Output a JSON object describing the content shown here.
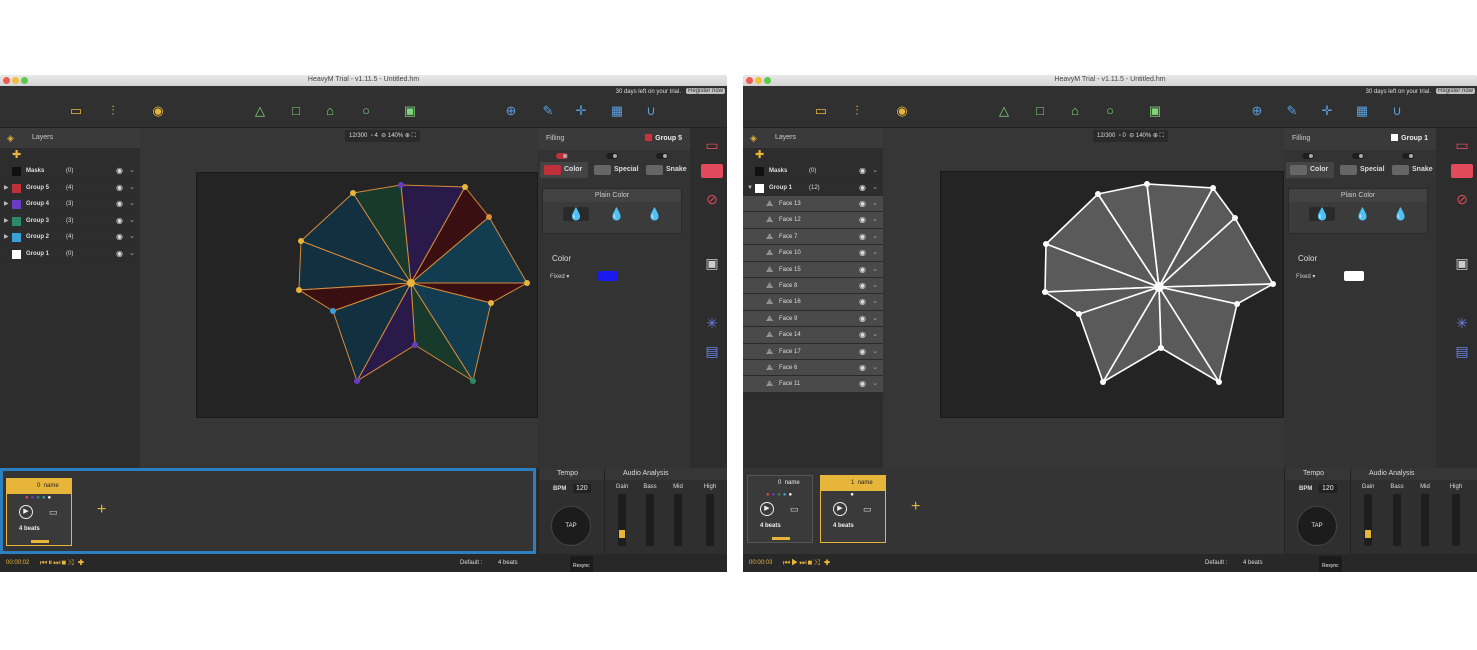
{
  "windows": [
    {
      "title": "HeavyM Trial - v1.11.5 - Untitled.hm",
      "trial_text": "30 days left on your trial.",
      "register_label": "Register now",
      "layers_label": "Layers",
      "canvas_faces": "12/300",
      "canvas_count": "4",
      "zoom": "140%",
      "layers": [
        {
          "name": "Masks",
          "count": "(0)",
          "color": "#111111"
        },
        {
          "name": "Group 5",
          "count": "(4)",
          "color": "#c0303a"
        },
        {
          "name": "Group 4",
          "count": "(3)",
          "color": "#6a3cc4"
        },
        {
          "name": "Group 3",
          "count": "(3)",
          "color": "#2a8a6a"
        },
        {
          "name": "Group 2",
          "count": "(4)",
          "color": "#3aa0d8"
        },
        {
          "name": "Group 1",
          "count": "(0)",
          "color": "#ffffff"
        }
      ],
      "props": {
        "filling": "Filling",
        "group": "Group 5",
        "group_color": "#d0303a",
        "tabs": [
          "Color",
          "Special",
          "Snake"
        ],
        "plain_color": "Plain Color",
        "color_label": "Color",
        "fixed": "Fixed",
        "swatch": "#1a1aee"
      },
      "clips": [
        {
          "index": "0",
          "name": "name",
          "beats": "4 beats"
        }
      ],
      "time": "00:00:02",
      "default_label": "Default :",
      "default_beats": "4 beats",
      "tempo": {
        "label": "Tempo",
        "bpm_label": "BPM",
        "bpm": "120",
        "tap": "TAP",
        "resync": "Resync"
      },
      "audio": {
        "label": "Audio Analysis",
        "bands": [
          "Gain",
          "Bass",
          "Mid",
          "High"
        ]
      }
    },
    {
      "title": "HeavyM Trial - v1.11.5 - Untitled.hm",
      "trial_text": "30 days left on your trial.",
      "register_label": "Register now",
      "layers_label": "Layers",
      "canvas_faces": "12/300",
      "canvas_count": "0",
      "zoom": "140%",
      "layers": [
        {
          "name": "Masks",
          "count": "(0)",
          "color": "#111111"
        },
        {
          "name": "Group 1",
          "count": "(12)",
          "color": "#ffffff"
        }
      ],
      "faces": [
        "Face 13",
        "Face 12",
        "Face 7",
        "Face 10",
        "Face 15",
        "Face 8",
        "Face 16",
        "Face 9",
        "Face 14",
        "Face 17",
        "Face 6",
        "Face 11"
      ],
      "props": {
        "filling": "Filling",
        "group": "Group 1",
        "group_color": "#ffffff",
        "tabs": [
          "Color",
          "Special",
          "Snake"
        ],
        "plain_color": "Plain Color",
        "color_label": "Color",
        "fixed": "Fixed",
        "swatch": "#ffffff"
      },
      "clips": [
        {
          "index": "0",
          "name": "name",
          "beats": "4 beats"
        },
        {
          "index": "1",
          "name": "name",
          "beats": "4 beats"
        }
      ],
      "time": "00:00:03",
      "default_label": "Default :",
      "default_beats": "4 beats",
      "tempo": {
        "label": "Tempo",
        "bpm_label": "BPM",
        "bpm": "120",
        "tap": "TAP",
        "resync": "Resync"
      },
      "audio": {
        "label": "Audio Analysis",
        "bands": [
          "Gain",
          "Bass",
          "Mid",
          "High"
        ]
      }
    }
  ]
}
